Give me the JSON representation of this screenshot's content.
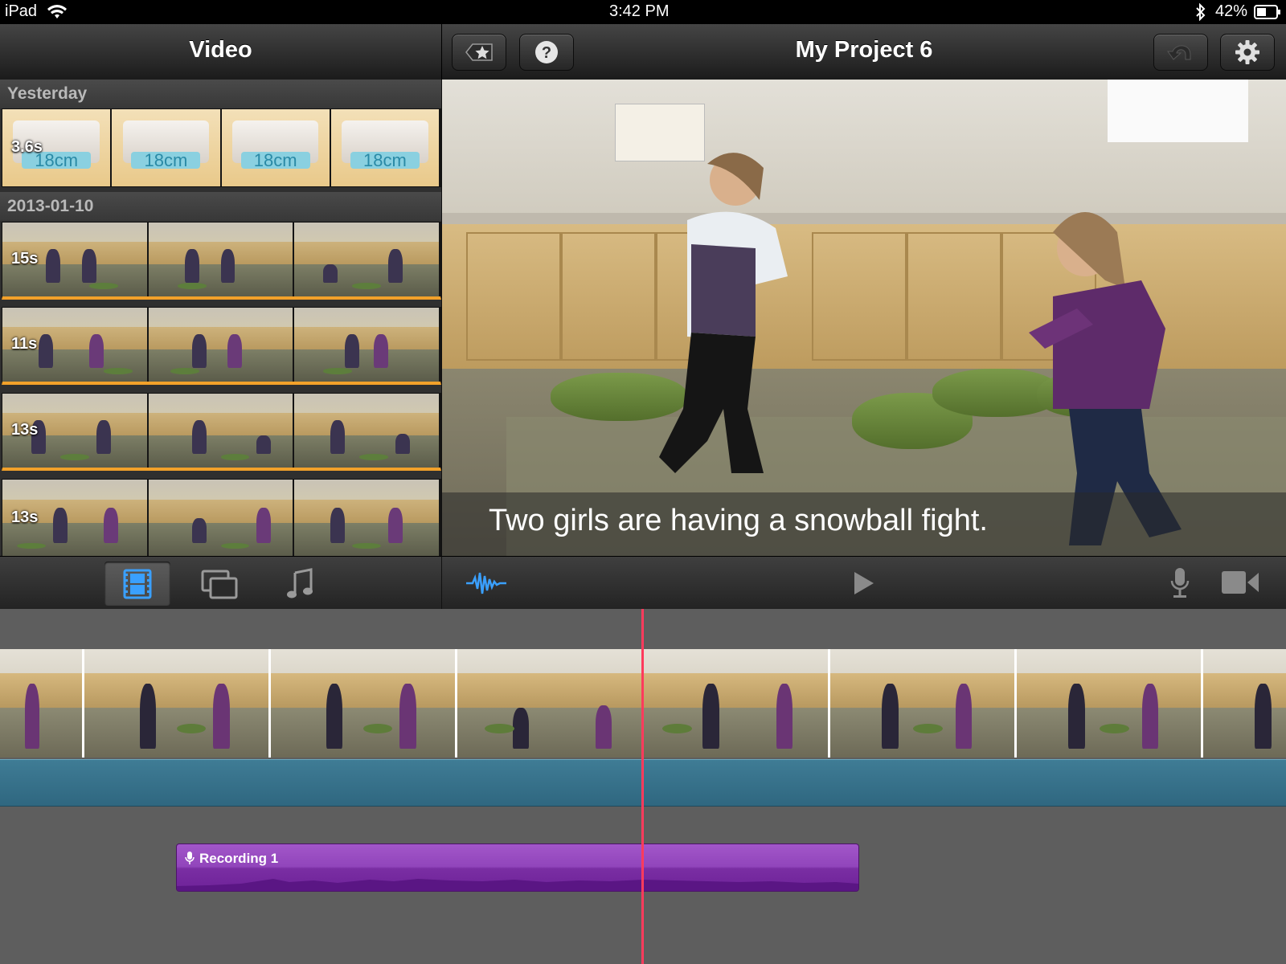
{
  "status_bar": {
    "device": "iPad",
    "time": "3:42 PM",
    "battery": "42%",
    "icons": [
      "wifi-icon",
      "bluetooth-icon",
      "battery-icon"
    ]
  },
  "browser": {
    "title": "Video",
    "sections": [
      {
        "label": "Yesterday",
        "clips": [
          {
            "duration": "3.6s",
            "used": false
          }
        ]
      },
      {
        "label": "2013-01-10",
        "clips": [
          {
            "duration": "15s",
            "used": true
          },
          {
            "duration": "11s",
            "used": true
          },
          {
            "duration": "13s",
            "used": true
          },
          {
            "duration": "13s",
            "used": false
          }
        ]
      }
    ],
    "bin_label": "18cm",
    "tabs": [
      {
        "name": "video-tab",
        "icon": "film-icon",
        "active": true
      },
      {
        "name": "photos-tab",
        "icon": "photos-icon",
        "active": false
      },
      {
        "name": "audio-tab",
        "icon": "music-note-icon",
        "active": false
      }
    ]
  },
  "project": {
    "title": "My Project 6",
    "buttons": [
      "projects-star-button",
      "help-button",
      "undo-button",
      "settings-button"
    ]
  },
  "viewer": {
    "caption": "Two girls are having a snowball fight.",
    "toolbar": [
      "audio-waveform-button",
      "play-button",
      "microphone-button",
      "camera-button"
    ]
  },
  "timeline": {
    "recording_label": "Recording 1"
  },
  "colors": {
    "accent_blue": "#3aa0ff",
    "used_marker": "#f2a12a",
    "recording": "#8e44b8",
    "playhead": "#ff3b5c",
    "audio_track": "#35708a"
  }
}
